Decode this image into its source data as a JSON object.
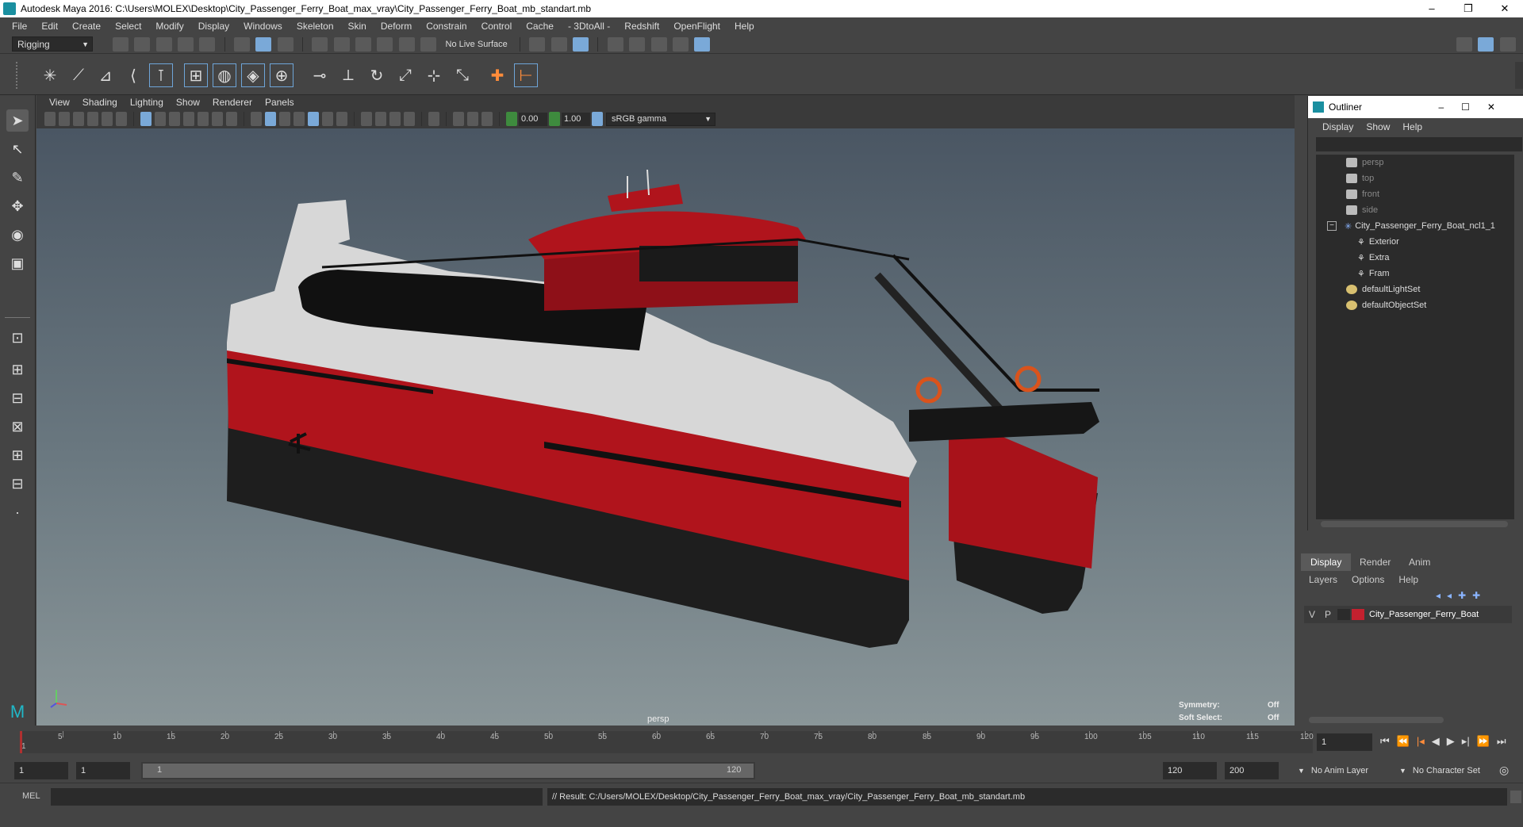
{
  "window": {
    "title": "Autodesk Maya 2016: C:\\Users\\MOLEX\\Desktop\\City_Passenger_Ferry_Boat_max_vray\\City_Passenger_Ferry_Boat_mb_standart.mb",
    "min": "–",
    "restore": "❐",
    "close": "✕"
  },
  "menu": [
    "File",
    "Edit",
    "Create",
    "Select",
    "Modify",
    "Display",
    "Windows",
    "Skeleton",
    "Skin",
    "Deform",
    "Constrain",
    "Control",
    "Cache",
    "- 3DtoAll -",
    "Redshift",
    "OpenFlight",
    "Help"
  ],
  "statusline": {
    "mode": "Rigging",
    "live_surface": "No Live Surface"
  },
  "viewport": {
    "menu": [
      "View",
      "Shading",
      "Lighting",
      "Show",
      "Renderer",
      "Panels"
    ],
    "exposure": "0.00",
    "gamma": "1.00",
    "colorspace": "sRGB gamma",
    "camera_label": "persp",
    "hud": [
      {
        "label": "Symmetry:",
        "value": "Off"
      },
      {
        "label": "Soft Select:",
        "value": "Off"
      }
    ]
  },
  "outliner": {
    "title": "Outliner",
    "menu": [
      "Display",
      "Show",
      "Help"
    ],
    "items": [
      {
        "label": "persp",
        "dim": true
      },
      {
        "label": "top",
        "dim": true
      },
      {
        "label": "front",
        "dim": true
      },
      {
        "label": "side",
        "dim": true
      },
      {
        "label": "City_Passenger_Ferry_Boat_ncl1_1",
        "dim": false
      },
      {
        "label": "Exterior",
        "dim": false
      },
      {
        "label": "Extra",
        "dim": false
      },
      {
        "label": "Fram",
        "dim": false
      },
      {
        "label": "defaultLightSet",
        "dim": false
      },
      {
        "label": "defaultObjectSet",
        "dim": false
      }
    ]
  },
  "layers": {
    "tabs": [
      "Display",
      "Render",
      "Anim"
    ],
    "menu": [
      "Layers",
      "Options",
      "Help"
    ],
    "row": {
      "v": "V",
      "p": "P",
      "name": "City_Passenger_Ferry_Boat",
      "color": "#c4212f"
    }
  },
  "timeline": {
    "ticks": [
      "5",
      "10",
      "15",
      "20",
      "25",
      "30",
      "35",
      "40",
      "45",
      "50",
      "55",
      "60",
      "65",
      "70",
      "75",
      "80",
      "85",
      "90",
      "95",
      "100",
      "105",
      "110",
      "115",
      "120"
    ],
    "start_label": "1",
    "current_frame": "1"
  },
  "range": {
    "start": "1",
    "start2": "1",
    "slider_start": "1",
    "slider_end": "120",
    "end": "120",
    "end2": "200",
    "anim_layer": "No Anim Layer",
    "char_set": "No Character Set"
  },
  "cmd": {
    "lang": "MEL",
    "result": "// Result: C:/Users/MOLEX/Desktop/City_Passenger_Ferry_Boat_max_vray/City_Passenger_Ferry_Boat_mb_standart.mb"
  },
  "colors": {
    "hull_red": "#b0141c",
    "hull_white": "#d7d7d7",
    "hull_black": "#1c1c1c",
    "accent_blue": "#7aa9d8"
  }
}
